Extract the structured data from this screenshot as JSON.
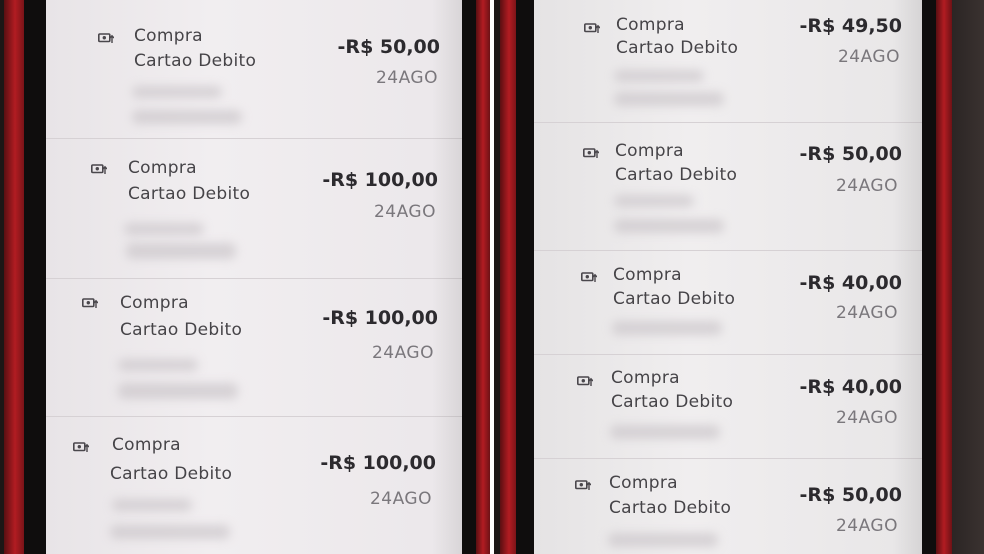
{
  "left_phone": {
    "transactions": [
      {
        "type": "Compra",
        "method": "Cartao Debito",
        "amount": "-R$ 50,00",
        "date": "24AGO"
      },
      {
        "type": "Compra",
        "method": "Cartao Debito",
        "amount": "-R$ 100,00",
        "date": "24AGO"
      },
      {
        "type": "Compra",
        "method": "Cartao Debito",
        "amount": "-R$ 100,00",
        "date": "24AGO"
      },
      {
        "type": "Compra",
        "method": "Cartao Debito",
        "amount": "-R$ 100,00",
        "date": "24AGO"
      }
    ]
  },
  "right_phone": {
    "transactions": [
      {
        "type": "Compra",
        "method": "Cartao Debito",
        "amount": "-R$ 49,50",
        "date": "24AGO"
      },
      {
        "type": "Compra",
        "method": "Cartao Debito",
        "amount": "-R$ 50,00",
        "date": "24AGO"
      },
      {
        "type": "Compra",
        "method": "Cartao Debito",
        "amount": "-R$ 40,00",
        "date": "24AGO"
      },
      {
        "type": "Compra",
        "method": "Cartao Debito",
        "amount": "-R$ 40,00",
        "date": "24AGO"
      },
      {
        "type": "Compra",
        "method": "Cartao Debito",
        "amount": "-R$ 50,00",
        "date": "24AGO"
      }
    ]
  },
  "icon": "cash-out-icon",
  "colors": {
    "phone_case": "#b21c22",
    "screen_bg": "#efecef",
    "amount_text": "#2c2a2e",
    "date_text": "#7a777c"
  }
}
